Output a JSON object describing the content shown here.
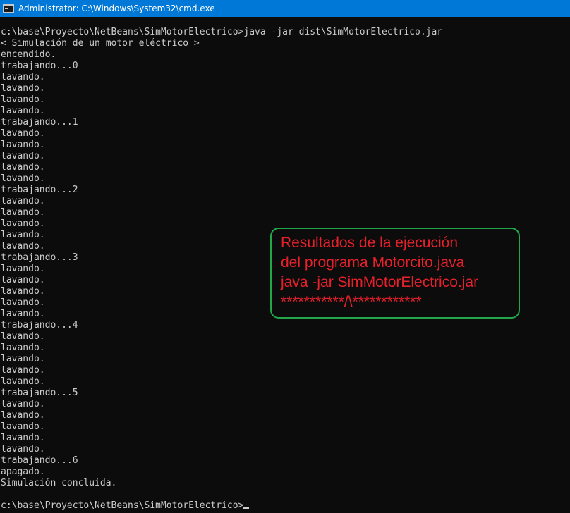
{
  "window": {
    "title": "Administrator: C:\\Windows\\System32\\cmd.exe",
    "icon": "console-icon"
  },
  "console": {
    "lines": [
      "c:\\base\\Proyecto\\NetBeans\\SimMotorElectrico>java -jar dist\\SimMotorElectrico.jar",
      "< Simulación de un motor eléctrico >",
      "encendido.",
      "trabajando...0",
      "lavando.",
      "lavando.",
      "lavando.",
      "lavando.",
      "trabajando...1",
      "lavando.",
      "lavando.",
      "lavando.",
      "lavando.",
      "lavando.",
      "trabajando...2",
      "lavando.",
      "lavando.",
      "lavando.",
      "lavando.",
      "lavando.",
      "trabajando...3",
      "lavando.",
      "lavando.",
      "lavando.",
      "lavando.",
      "lavando.",
      "trabajando...4",
      "lavando.",
      "lavando.",
      "lavando.",
      "lavando.",
      "lavando.",
      "trabajando...5",
      "lavando.",
      "lavando.",
      "lavando.",
      "lavando.",
      "lavando.",
      "trabajando...6",
      "apagado.",
      "Simulación concluida."
    ],
    "prompt": "c:\\base\\Proyecto\\NetBeans\\SimMotorElectrico>"
  },
  "annotation": {
    "lines": [
      "Resultados de la ejecución",
      "del programa Motorcito.java",
      "java -jar SimMotorElectrico.jar",
      "***********/\\************"
    ],
    "text_color": "#e8202a",
    "border_color": "#22a64a"
  },
  "colors": {
    "titlebar": "#0078d7",
    "console_bg": "#0c0c0c",
    "console_text": "#cccccc"
  }
}
